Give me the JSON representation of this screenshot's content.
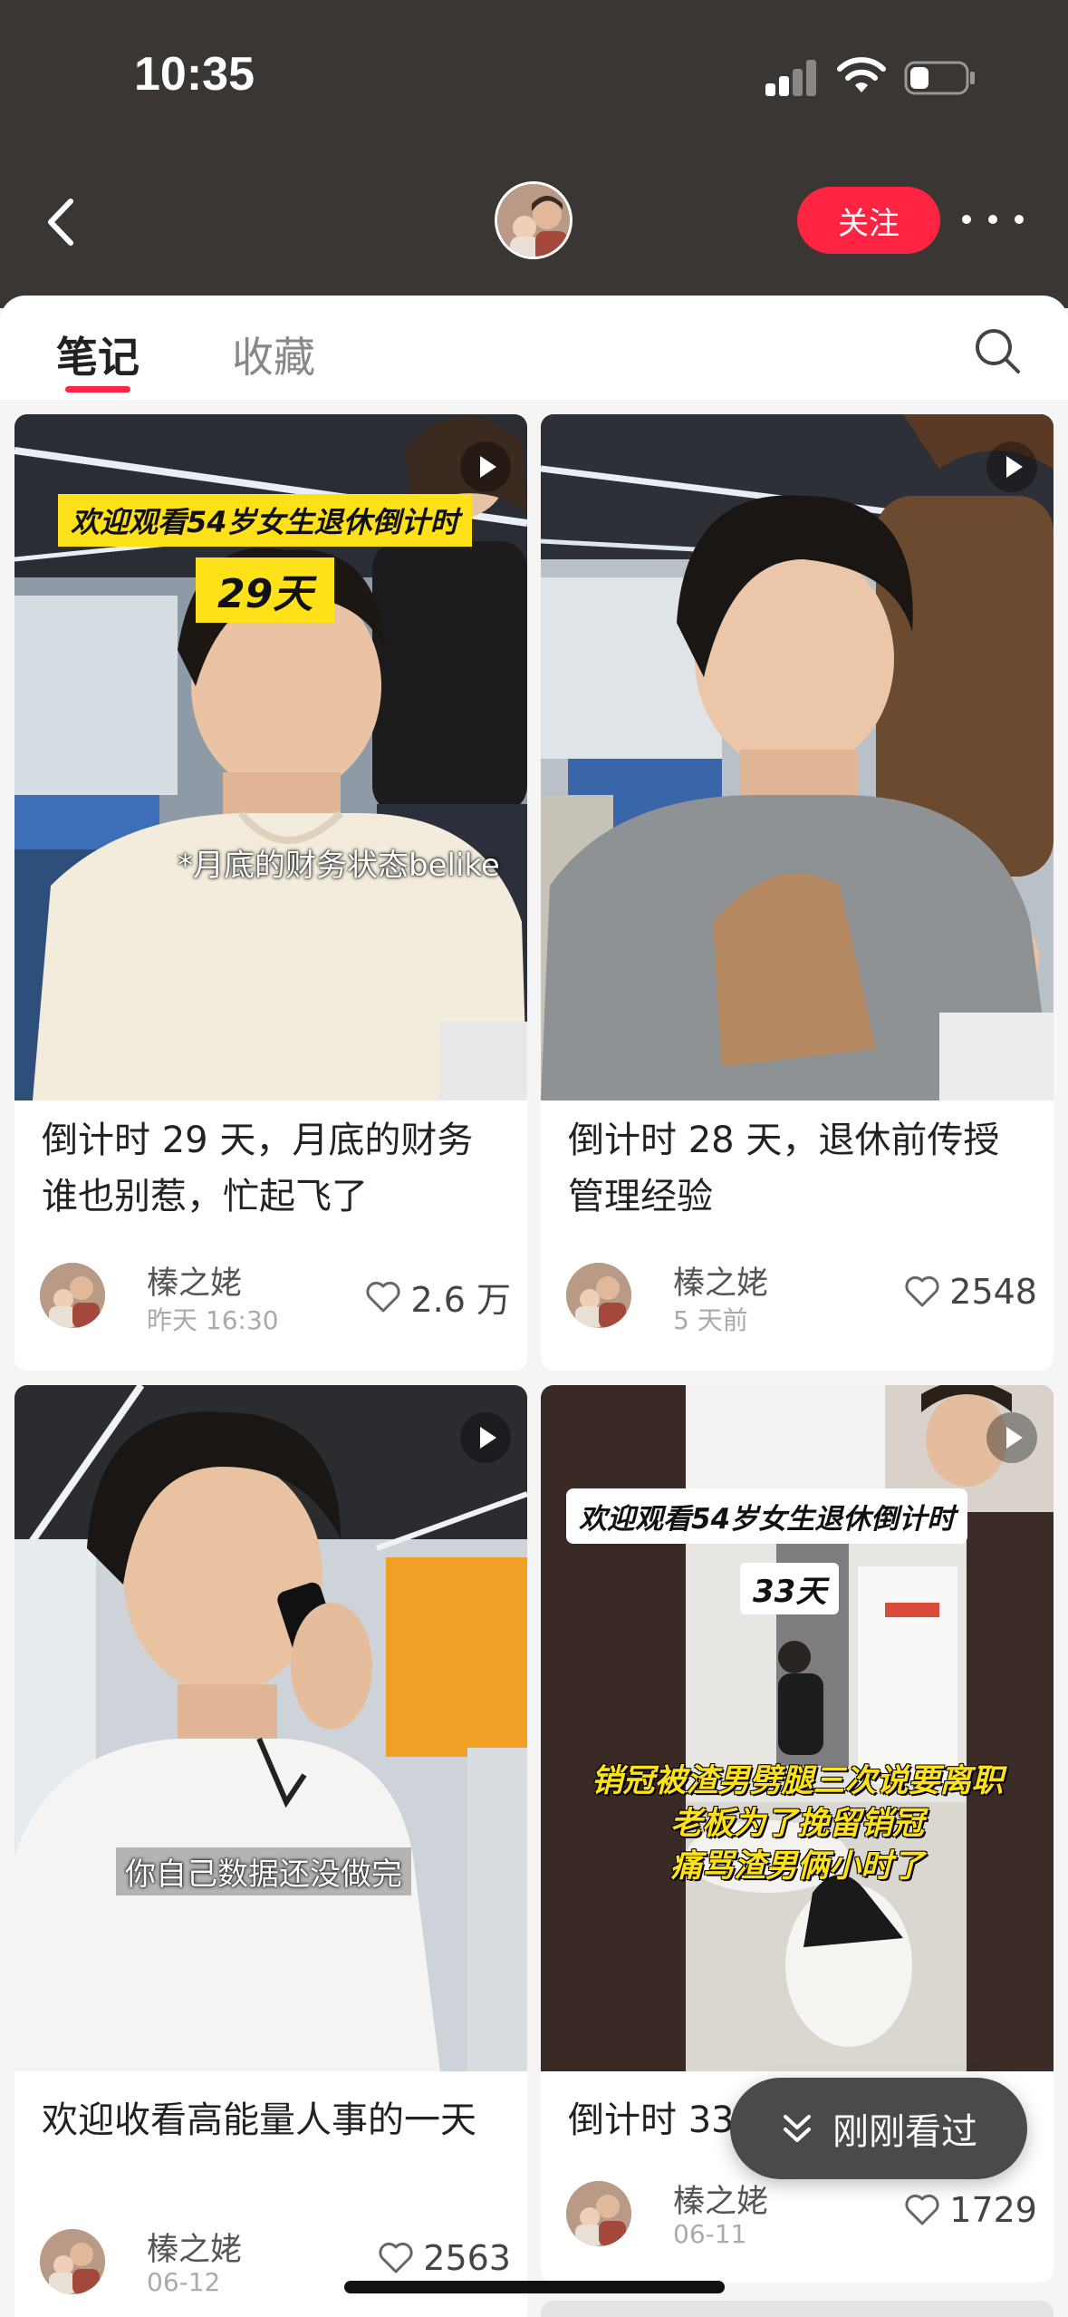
{
  "status_bar": {
    "time": "10:35"
  },
  "header": {
    "follow_label": "关注"
  },
  "tabs": [
    {
      "label": "笔记",
      "active": true
    },
    {
      "label": "收藏",
      "active": false
    }
  ],
  "accent_color": "#ff2442",
  "cards": [
    {
      "banner_line1": "欢迎观看54岁女生退休倒计时",
      "banner_days": "29天",
      "caption": "*月底的财务状态belike",
      "title": "倒计时 29 天，月底的财务谁也别惹，忙起飞了",
      "author": "榛之姥",
      "time": "昨天 16:30",
      "likes": "2.6 万"
    },
    {
      "title": "倒计时 28 天，退休前传授管理经验",
      "author": "榛之姥",
      "time": "5 天前",
      "likes": "2548"
    },
    {
      "caption": "你自己数据还没做完",
      "title": "欢迎收看高能量人事的一天",
      "author": "榛之姥",
      "time": "06-12",
      "likes": "2563"
    },
    {
      "banner_line1": "欢迎观看54岁女生退休倒计时",
      "banner_days": "33天",
      "yellow_line1": "销冠被渣男劈腿三次说要离职",
      "yellow_line2": "老板为了挽留销冠",
      "yellow_line3": "痛骂渣男俩小时了",
      "title": "倒计时 33",
      "author": "榛之姥",
      "time": "06-11",
      "likes": "1729"
    }
  ],
  "recent_button": {
    "label": "刚刚看过"
  }
}
